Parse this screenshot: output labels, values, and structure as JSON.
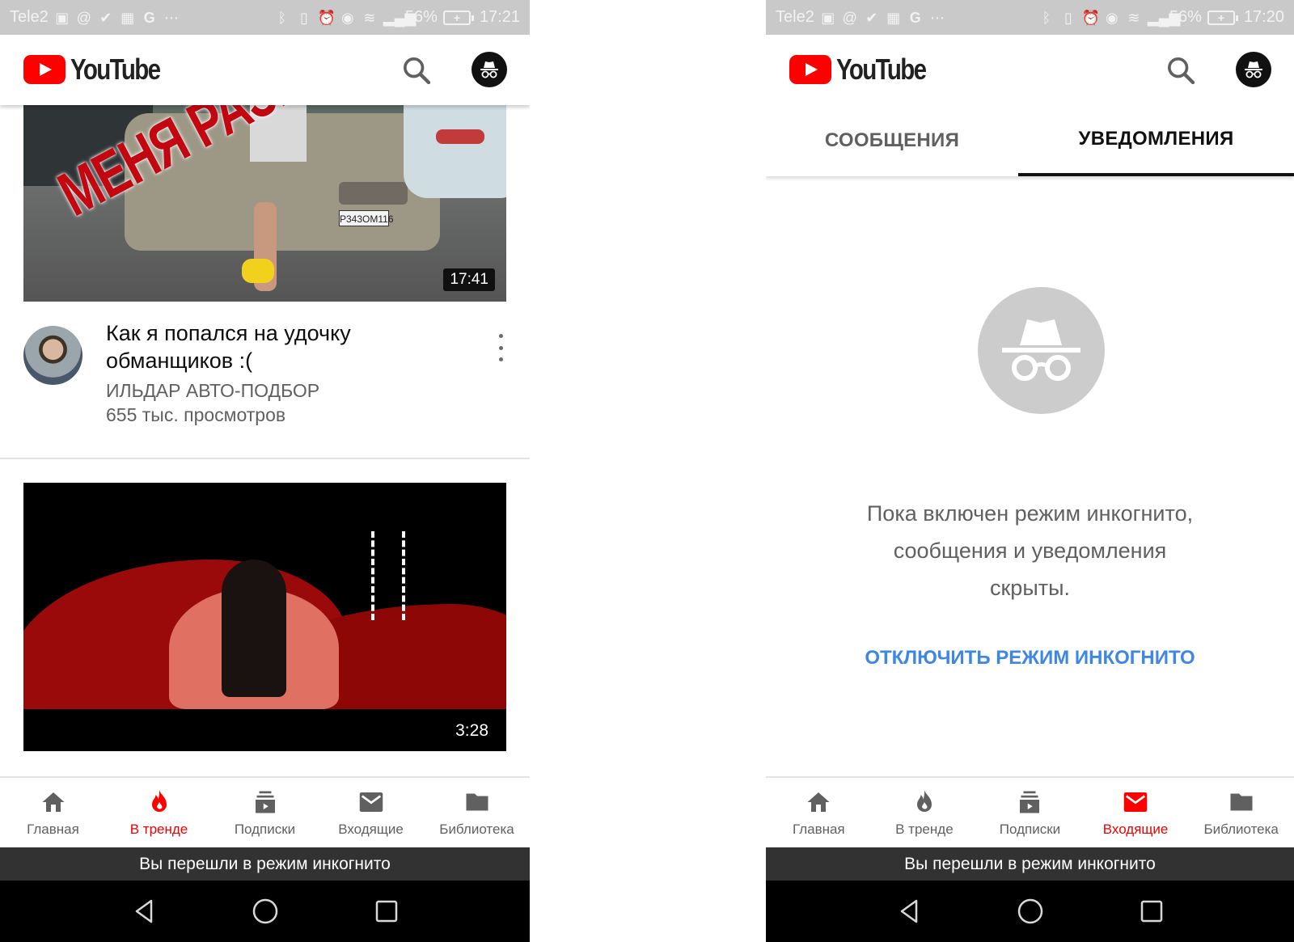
{
  "left": {
    "status_bar": {
      "carrier": "Tele2",
      "battery": "56%",
      "time": "17:21"
    },
    "app": {
      "logo_text": "YouTube"
    },
    "video1": {
      "thumbnail_overlay": "МЕНЯ РАЗВЕЛ!",
      "plate": "Р343ОМ116",
      "duration": "17:41",
      "title": "Как я попался на удочку обманщиков :(",
      "channel": "ИЛЬДАР АВТО-ПОДБОР",
      "views": "655 тыс. просмотров"
    },
    "video2": {
      "duration": "3:28"
    },
    "nav": {
      "active": "trending",
      "items": [
        {
          "id": "home",
          "label": "Главная",
          "icon": "home-icon"
        },
        {
          "id": "trending",
          "label": "В тренде",
          "icon": "flame-icon"
        },
        {
          "id": "subscriptions",
          "label": "Подписки",
          "icon": "subscriptions-icon"
        },
        {
          "id": "inbox",
          "label": "Входящие",
          "icon": "mail-icon"
        },
        {
          "id": "library",
          "label": "Библиотека",
          "icon": "folder-icon"
        }
      ]
    },
    "snackbar": "Вы перешли в режим инкогнито"
  },
  "right": {
    "status_bar": {
      "carrier": "Tele2",
      "battery": "56%",
      "time": "17:20"
    },
    "app": {
      "logo_text": "YouTube"
    },
    "tabs": [
      {
        "label": "СООБЩЕНИЯ",
        "active": false
      },
      {
        "label": "УВЕДОМЛЕНИЯ",
        "active": true
      }
    ],
    "empty_state": {
      "line1": "Пока включен режим инкогнито,",
      "line2": "сообщения и уведомления",
      "line3": "скрыты.",
      "action": "ОТКЛЮЧИТЬ РЕЖИМ ИНКОГНИТО"
    },
    "nav": {
      "active": "inbox",
      "items": [
        {
          "id": "home",
          "label": "Главная",
          "icon": "home-icon"
        },
        {
          "id": "trending",
          "label": "В тренде",
          "icon": "flame-icon"
        },
        {
          "id": "subscriptions",
          "label": "Подписки",
          "icon": "subscriptions-icon"
        },
        {
          "id": "inbox",
          "label": "Входящие",
          "icon": "mail-icon"
        },
        {
          "id": "library",
          "label": "Библиотека",
          "icon": "folder-icon"
        }
      ]
    },
    "snackbar": "Вы перешли в режим инкогнито"
  },
  "colors": {
    "brand_red": "#ff0000",
    "active_nav": "#ee0000",
    "link_blue": "#3f87e5",
    "snackbar": "#323232",
    "status_bar": "#c9c9c9"
  }
}
